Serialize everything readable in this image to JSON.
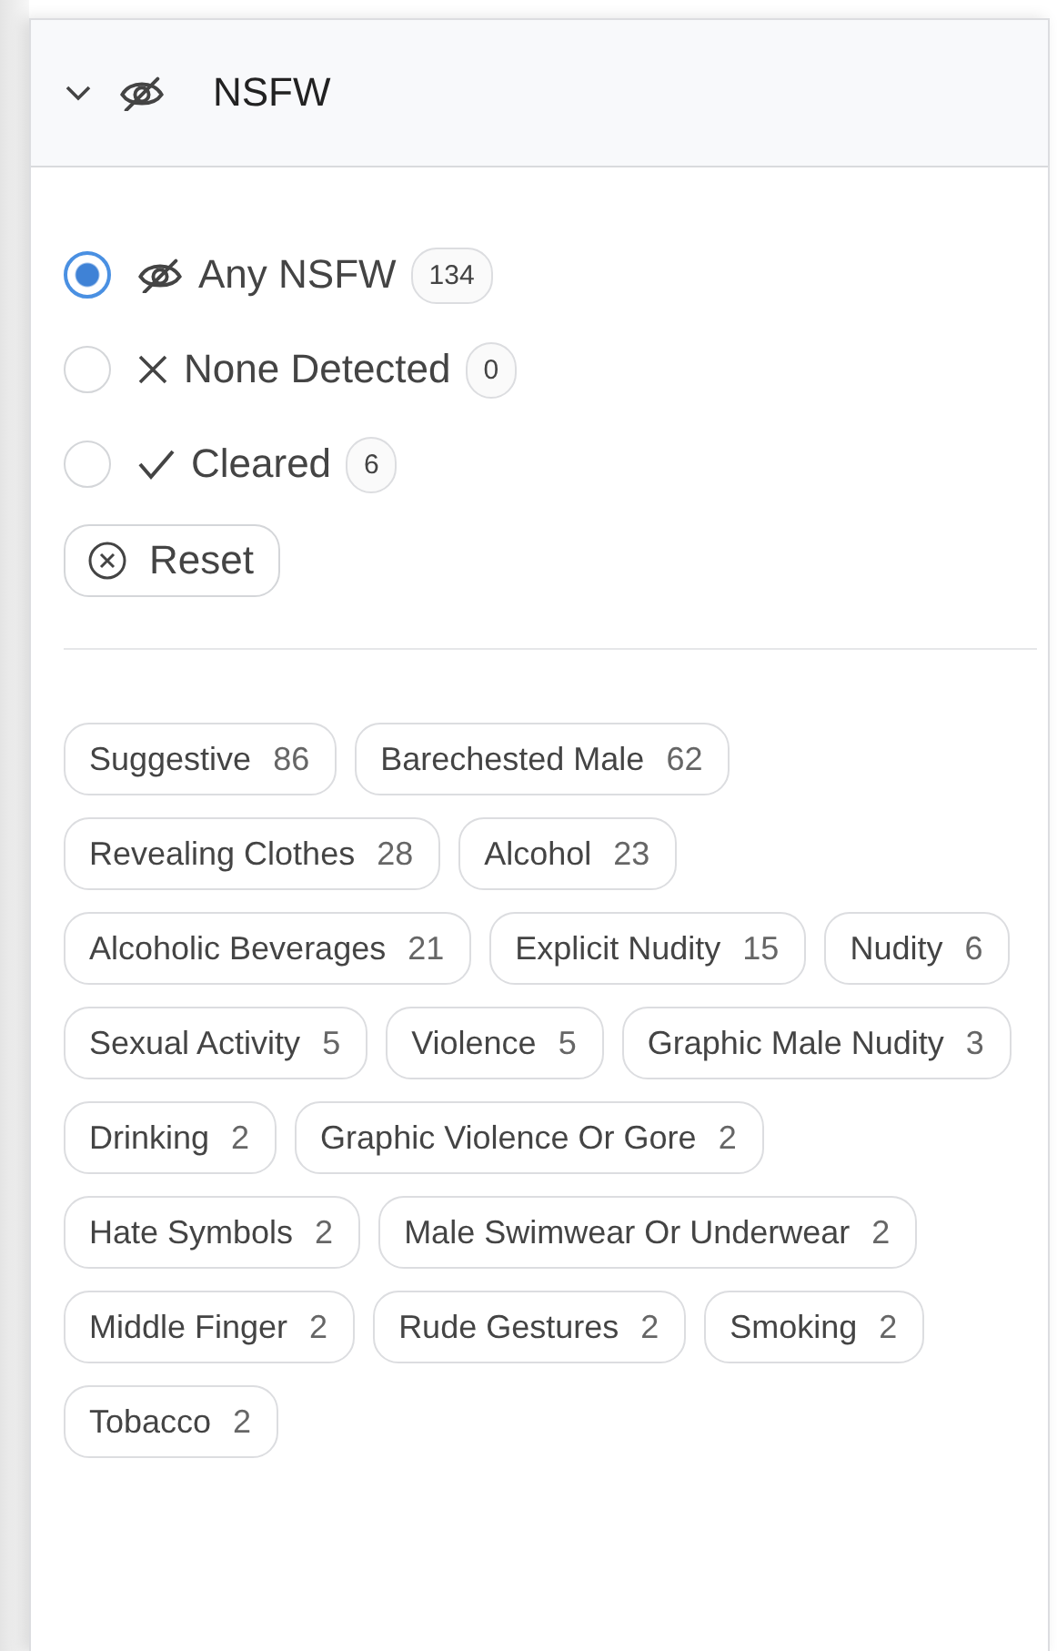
{
  "panel": {
    "title": "NSFW",
    "expanded": true
  },
  "options": [
    {
      "kind": "eye-slash",
      "label": "Any NSFW",
      "count": "134",
      "selected": true
    },
    {
      "kind": "x",
      "label": "None Detected",
      "count": "0",
      "selected": false
    },
    {
      "kind": "check",
      "label": "Cleared",
      "count": "6",
      "selected": false
    }
  ],
  "reset": {
    "label": "Reset"
  },
  "tags": [
    {
      "label": "Suggestive",
      "count": "86"
    },
    {
      "label": "Barechested Male",
      "count": "62"
    },
    {
      "label": "Revealing Clothes",
      "count": "28"
    },
    {
      "label": "Alcohol",
      "count": "23"
    },
    {
      "label": "Alcoholic Beverages",
      "count": "21"
    },
    {
      "label": "Explicit Nudity",
      "count": "15"
    },
    {
      "label": "Nudity",
      "count": "6"
    },
    {
      "label": "Sexual Activity",
      "count": "5"
    },
    {
      "label": "Violence",
      "count": "5"
    },
    {
      "label": "Graphic Male Nudity",
      "count": "3"
    },
    {
      "label": "Drinking",
      "count": "2"
    },
    {
      "label": "Graphic Violence Or Gore",
      "count": "2"
    },
    {
      "label": "Hate Symbols",
      "count": "2"
    },
    {
      "label": "Male Swimwear Or Underwear",
      "count": "2"
    },
    {
      "label": "Middle Finger",
      "count": "2"
    },
    {
      "label": "Rude Gestures",
      "count": "2"
    },
    {
      "label": "Smoking",
      "count": "2"
    },
    {
      "label": "Tobacco",
      "count": "2"
    }
  ]
}
